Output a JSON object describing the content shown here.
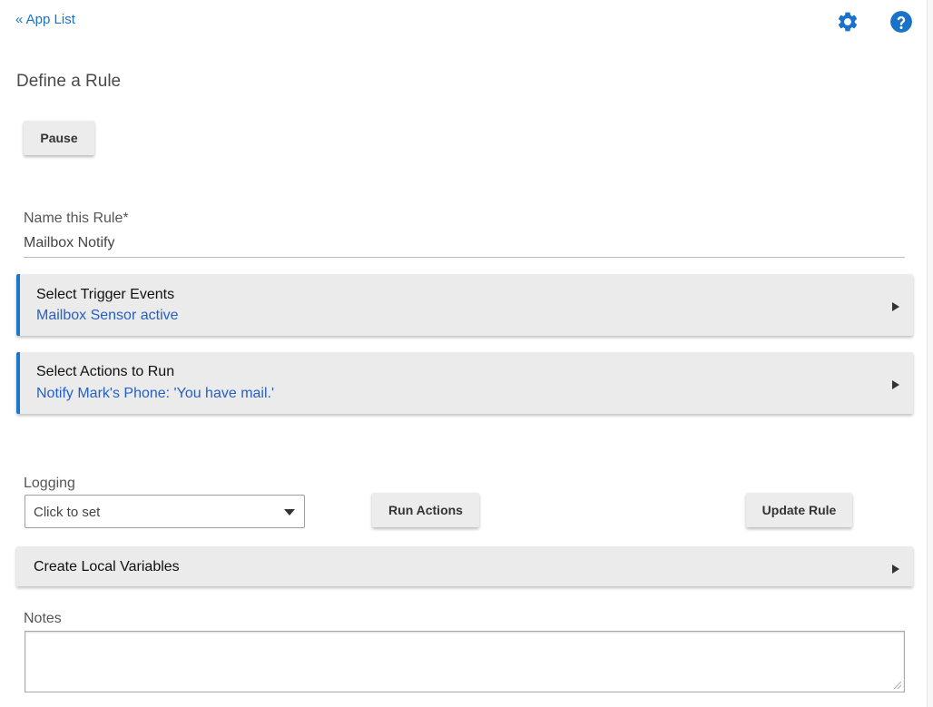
{
  "nav": {
    "back_label": "« App List",
    "settings_icon": "gear-icon",
    "help_icon": "help-circle-icon"
  },
  "page": {
    "title": "Define a Rule"
  },
  "buttons": {
    "pause": "Pause",
    "run_actions": "Run Actions",
    "update_rule": "Update Rule"
  },
  "rule_name": {
    "label": "Name this Rule*",
    "value": "Mailbox Notify"
  },
  "sections": {
    "triggers": {
      "title": "Select Trigger Events",
      "summary": "Mailbox Sensor active"
    },
    "actions": {
      "title": "Select Actions to Run",
      "summary": "Notify Mark's Phone: 'You have mail.'"
    },
    "local_vars": {
      "title": "Create Local Variables"
    }
  },
  "logging": {
    "label": "Logging",
    "selected": "Click to set"
  },
  "notes": {
    "label": "Notes",
    "value": ""
  },
  "colors": {
    "accent": "#1e78c8",
    "link": "#1a73c8",
    "summary_text": "#2660c4",
    "section_bg": "#ebebeb"
  }
}
